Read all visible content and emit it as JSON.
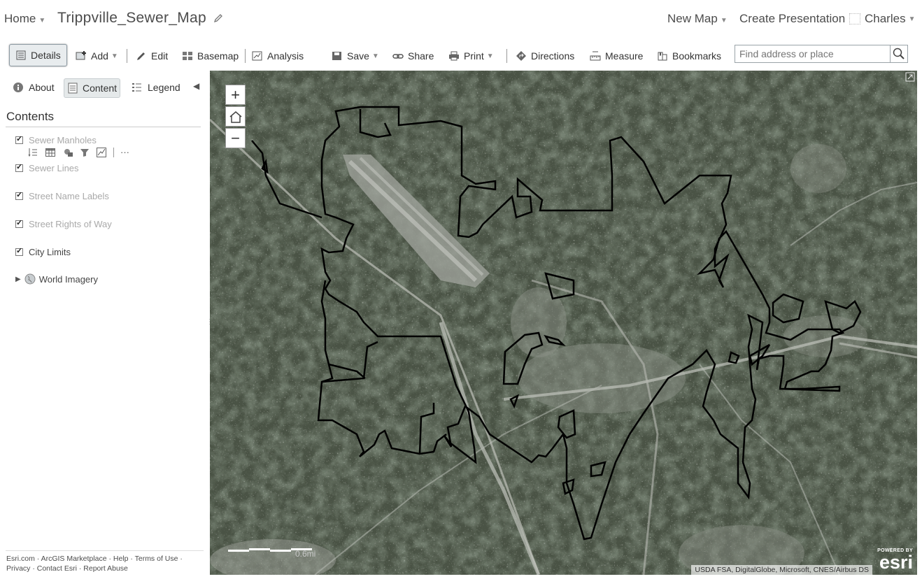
{
  "header": {
    "home_label": "Home",
    "map_title": "Trippville_Sewer_Map",
    "new_map_label": "New Map",
    "create_presentation_label": "Create Presentation",
    "user_name": "Charles"
  },
  "toolbar": {
    "details": "Details",
    "add": "Add",
    "edit": "Edit",
    "basemap": "Basemap",
    "analysis": "Analysis",
    "save": "Save",
    "share": "Share",
    "print": "Print",
    "directions": "Directions",
    "measure": "Measure",
    "bookmarks": "Bookmarks",
    "search_placeholder": "Find address or place"
  },
  "panel": {
    "tabs": {
      "about": "About",
      "content": "Content",
      "legend": "Legend"
    },
    "contents_heading": "Contents",
    "layers": [
      {
        "label": "Sewer Manholes",
        "checked": true,
        "dimmed": true
      },
      {
        "label": "Sewer Lines",
        "checked": true,
        "dimmed": true
      },
      {
        "label": "Street Name Labels",
        "checked": true,
        "dimmed": true
      },
      {
        "label": "Street Rights of Way",
        "checked": true,
        "dimmed": true
      },
      {
        "label": "City Limits",
        "checked": true,
        "dimmed": false
      },
      {
        "label": "World Imagery",
        "checked": false,
        "dimmed": false
      }
    ],
    "layer_tool_more": "···",
    "footer_line1": "Esri.com · ArcGIS Marketplace · Help · Terms of Use ·",
    "footer_line2": "Privacy · Contact Esri · Report Abuse"
  },
  "map": {
    "zoom_in": "+",
    "zoom_out": "−",
    "scale_label": "0.6mi",
    "attribution": "USDA FSA, DigitalGlobe, Microsoft, CNES/Airbus DS",
    "powered_by": "POWERED BY",
    "esri_logo_text": "esri"
  },
  "colors": {
    "boundary": "#000000",
    "imagery_base": "#3c4438",
    "active_tab_bg": "#e5e9ea"
  }
}
